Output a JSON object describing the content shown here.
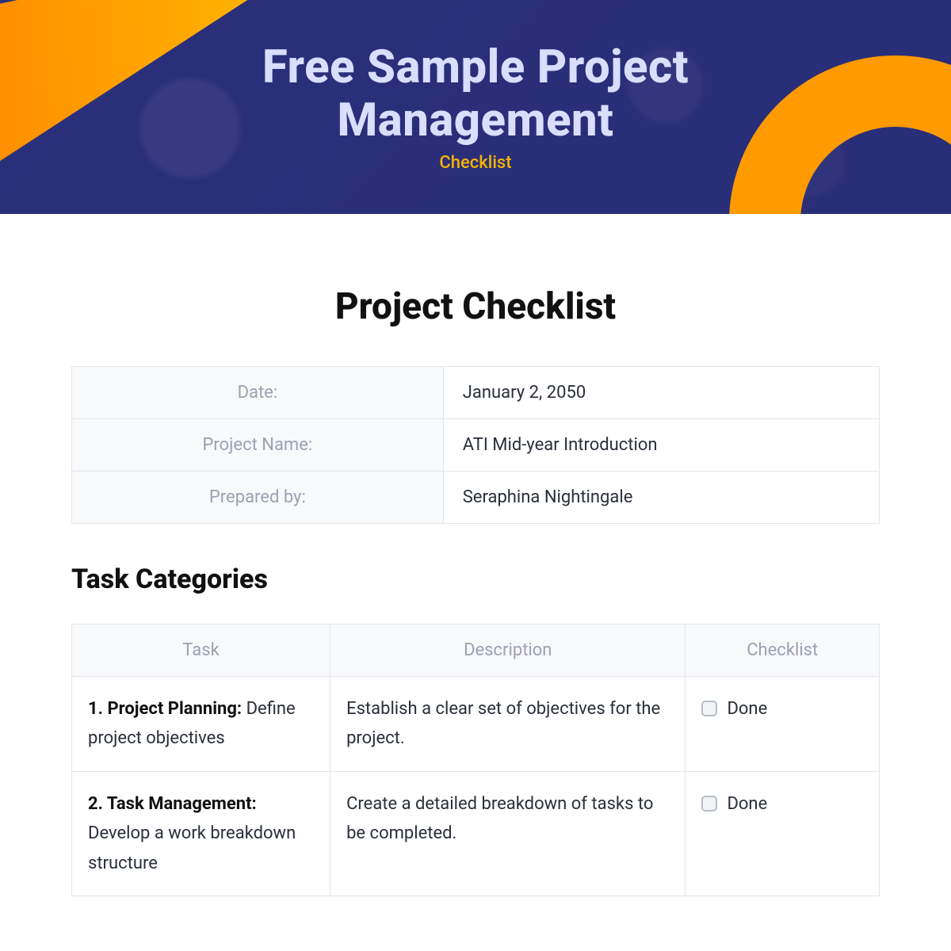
{
  "hero": {
    "title": "Free Sample Project Management",
    "subtitle": "Checklist"
  },
  "main": {
    "heading": "Project Checklist",
    "info": {
      "date_label": "Date:",
      "date_value": "January 2, 2050",
      "project_label": "Project Name:",
      "project_value": "ATI Mid-year Introduction",
      "prepared_label": "Prepared by:",
      "prepared_value": "Seraphina Nightingale"
    },
    "subheading": "Task Categories",
    "table": {
      "headers": {
        "task": "Task",
        "description": "Description",
        "checklist": "Checklist"
      },
      "rows": [
        {
          "task_title": "1. Project Planning:",
          "task_body": "Define project objectives",
          "description": "Establish a clear set of objectives for the project.",
          "check_label": "Done"
        },
        {
          "task_title": "2. Task Management:",
          "task_body": "Develop a work breakdown structure",
          "description": "Create a detailed breakdown of tasks to be completed.",
          "check_label": "Done"
        }
      ]
    }
  }
}
